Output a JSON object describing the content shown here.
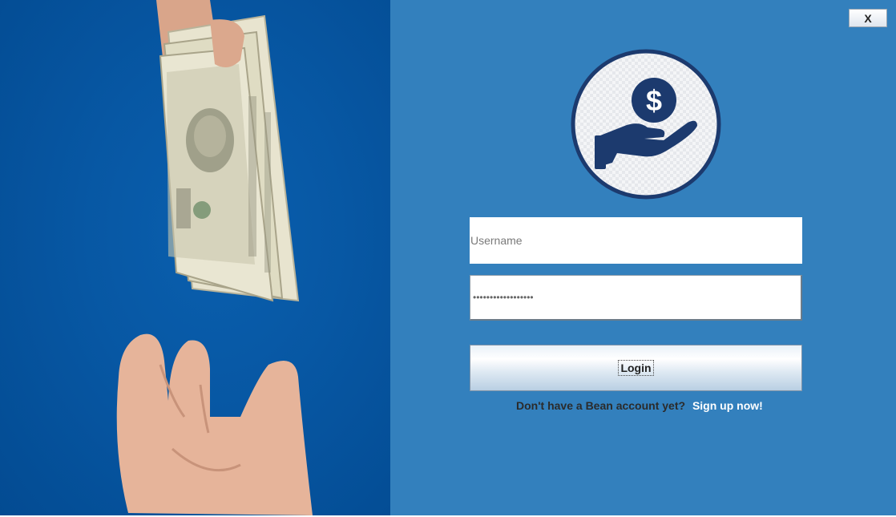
{
  "window": {
    "close_label": "X"
  },
  "hero": {
    "image_description_icon": "money-handoff-photo"
  },
  "logo": {
    "icon": "hand-holding-dollar-icon",
    "symbol": "$"
  },
  "login_form": {
    "username_placeholder": "Username",
    "username_value": "",
    "password_value": "••••••••••••••••••",
    "login_label": "Login"
  },
  "signup": {
    "prompt": "Don't have a Bean account yet?",
    "link_label": "Sign up now!"
  },
  "colors": {
    "left_background": "#0757a3",
    "right_background": "#3380bd",
    "logo_navy": "#1c3a6e"
  }
}
